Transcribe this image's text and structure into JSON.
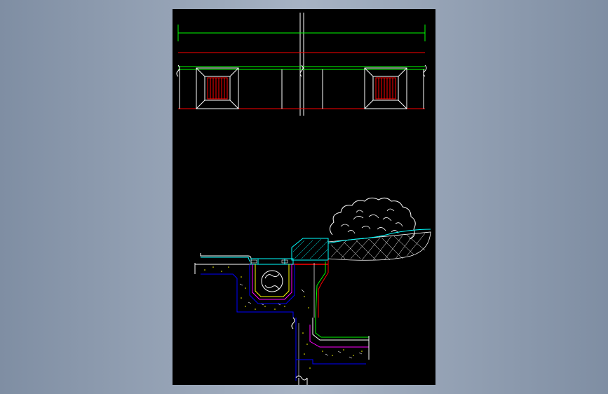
{
  "viewer": {
    "background_colors": [
      "#7f8ea3",
      "#a7b3c4"
    ],
    "sheet_color": "#000000"
  },
  "drawing": {
    "elevation_view": {
      "panels": [
        "left-panel",
        "right-panel"
      ],
      "line_colors": {
        "green": "#00ff00",
        "red": "#ff0000",
        "white": "#ffffff",
        "vent_fill": "#ff0000"
      }
    },
    "section_view": {
      "line_colors": {
        "cyan": "#00ffff",
        "yellow": "#ffff00",
        "magenta": "#ff00ff",
        "blue": "#0000ff",
        "green": "#00ff00",
        "red": "#ff0000",
        "white": "#ffffff"
      },
      "elements": [
        "stepped-slab",
        "drain-channel",
        "drain-pipe",
        "retaining-wall",
        "planter-soil",
        "shrub-outline"
      ]
    }
  }
}
